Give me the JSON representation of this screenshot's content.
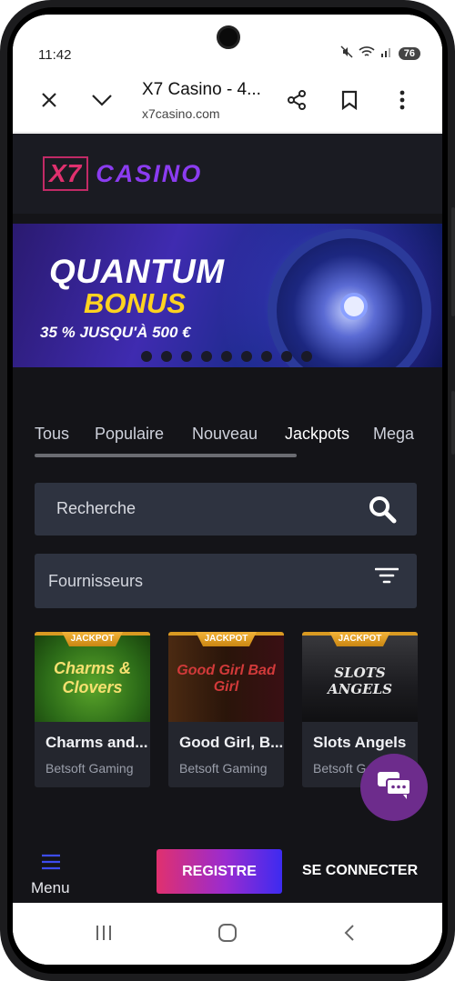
{
  "status": {
    "time": "11:42",
    "battery": "76"
  },
  "browser": {
    "title": "X7 Casino - 4...",
    "url": "x7casino.com"
  },
  "logo": {
    "x7": "X7",
    "casino": "CASINO"
  },
  "banner": {
    "title_line1": "QUANTUM",
    "title_line2": "BONUS",
    "subtitle": "35 % JUSQU'À 500 €",
    "slide_count": 9
  },
  "tabs": [
    "Tous",
    "Populaire",
    "Nouveau",
    "Jackpots",
    "Mega"
  ],
  "active_tab": "Jackpots",
  "search": {
    "placeholder": "Recherche"
  },
  "providers": {
    "label": "Fournisseurs"
  },
  "games": [
    {
      "badge": "JACKPOT",
      "thumb_text": "Charms & Clovers",
      "name": "Charms and...",
      "provider": "Betsoft Gaming"
    },
    {
      "badge": "JACKPOT",
      "thumb_text": "Good Girl Bad Girl",
      "name": "Good Girl, B...",
      "provider": "Betsoft Gaming"
    },
    {
      "badge": "JACKPOT",
      "thumb_text": "SLOTS ANGELS",
      "name": "Slots Angels",
      "provider": "Betsoft G"
    }
  ],
  "bottom": {
    "menu_label": "Menu",
    "register_label": "REGISTRE",
    "login_label": "SE CONNECTER"
  },
  "colors": {
    "site_bg": "#141418",
    "accent_pink": "#e0306e",
    "accent_purple": "#8b3cf0",
    "chat_bubble": "#6d2c8c",
    "jackpot_gold": "#d99a22"
  }
}
